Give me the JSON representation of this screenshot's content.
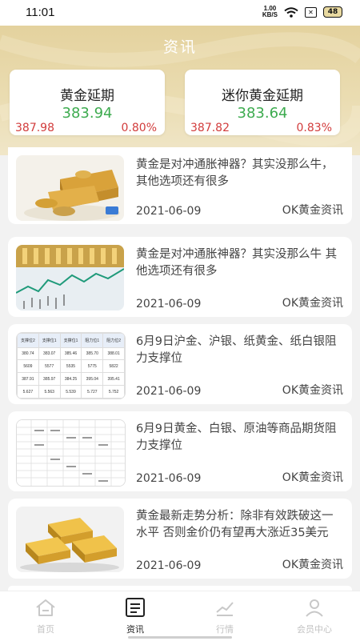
{
  "status_bar": {
    "time": "11:01",
    "net_speed_value": "1.00",
    "net_speed_unit": "KB/S",
    "battery": "48"
  },
  "header": {
    "title": "资讯"
  },
  "quotes": [
    {
      "name": "黄金延期",
      "price": "383.94",
      "base": "387.98",
      "change_pct": "0.80%"
    },
    {
      "name": "迷你黄金延期",
      "price": "383.64",
      "base": "387.82",
      "change_pct": "0.83%"
    }
  ],
  "news": [
    {
      "title": "黄金是对冲通胀神器？其实没那么牛，其他选项还有很多",
      "date": "2021-06-09",
      "source": "OK黄金资讯"
    },
    {
      "title": "黄金是对冲通胀神器？其实没那么牛 其他选项还有很多",
      "date": "2021-06-09",
      "source": "OK黄金资讯"
    },
    {
      "title": "6月9日沪金、沪银、纸黄金、纸白银阻力支撑位",
      "date": "2021-06-09",
      "source": "OK黄金资讯"
    },
    {
      "title": "6月9日黄金、白银、原油等商品期货阻力支撑位",
      "date": "2021-06-09",
      "source": "OK黄金资讯"
    },
    {
      "title": "黄金最新走势分析：除非有效跌破这一水平 否则金价仍有望再大涨近35美元",
      "date": "2021-06-09",
      "source": "OK黄金资讯"
    }
  ],
  "thumb_tables": {
    "table1": [
      [
        "支撑位2",
        "支撑位1",
        "支撑位1",
        "阻力位1",
        "阻力位2"
      ],
      [
        "380.74",
        "383.07",
        "385.46",
        "385.70",
        "388.01"
      ],
      [
        "5609",
        "5577",
        "5535",
        "5775",
        "5822"
      ],
      [
        "387.91",
        "385.97",
        "384.25",
        "395.04",
        "395.41"
      ],
      [
        "5.627",
        "5.563",
        "5.539",
        "5.727",
        "5.752"
      ]
    ]
  },
  "tabbar": {
    "items": [
      {
        "label": "首页",
        "icon": "home-icon",
        "active": false
      },
      {
        "label": "资讯",
        "icon": "news-icon",
        "active": true
      },
      {
        "label": "行情",
        "icon": "chart-icon",
        "active": false
      },
      {
        "label": "会员中心",
        "icon": "member-icon",
        "active": false
      }
    ]
  },
  "colors": {
    "accent_gold": "#e4d29e",
    "price_up_green": "#3dab4f",
    "down_red": "#d23c3c"
  }
}
